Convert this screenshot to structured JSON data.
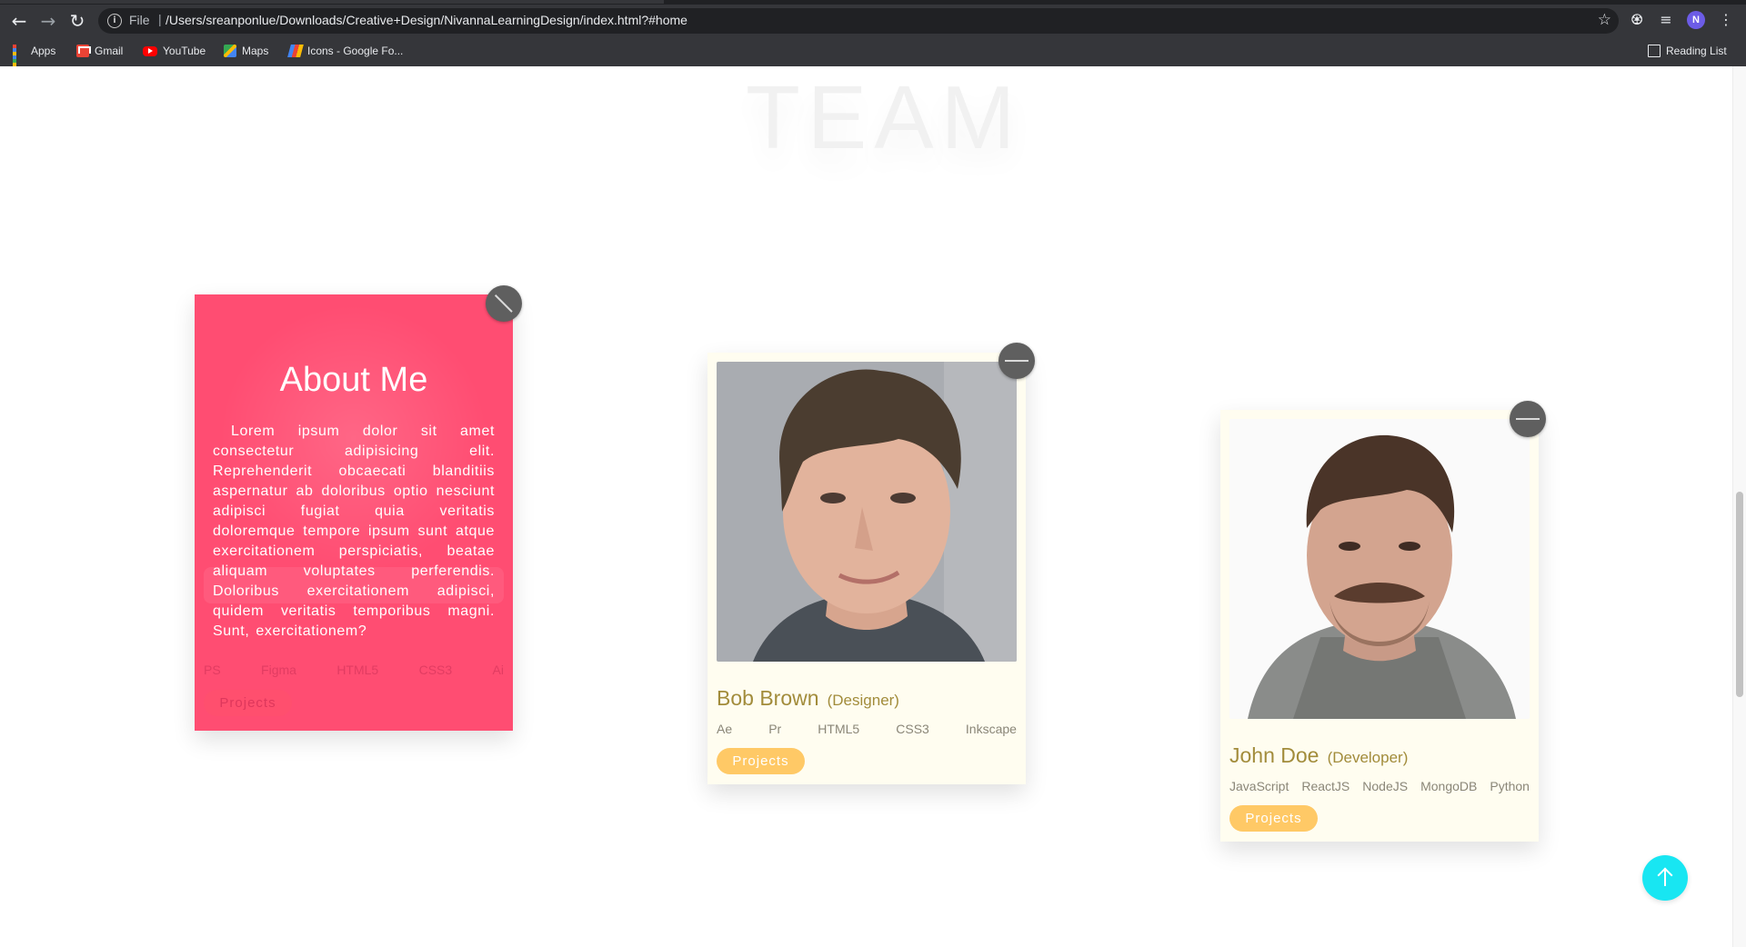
{
  "browser": {
    "url_scheme": "File",
    "url": "/Users/sreanponlue/Downloads/Creative+Design/NivannaLearningDesign/index.html?#home",
    "profile_initial": "N",
    "bookmarks": [
      {
        "label": "Apps",
        "icon": "apps-grid-icon"
      },
      {
        "label": "Gmail",
        "icon": "gmail-icon"
      },
      {
        "label": "YouTube",
        "icon": "youtube-icon"
      },
      {
        "label": "Maps",
        "icon": "maps-icon"
      },
      {
        "label": "Icons - Google Fo...",
        "icon": "google-fonts-icon"
      }
    ],
    "reading_list_label": "Reading List"
  },
  "page": {
    "section_title": "TEAM",
    "about_card": {
      "title": "About Me",
      "text": "Lorem ipsum dolor sit amet consectetur adipisicing elit. Reprehenderit obcaecati blanditiis aspernatur ab doloribus optio nesciunt adipisci fugiat quia veritatis doloremque tempore ipsum sunt atque exercitationem perspiciatis, beatae aliquam voluptates perferendis. Doloribus exercitationem adipisci, quidem veritatis temporibus magni. Sunt, exercitationem?",
      "ghost_skills": [
        "PS",
        "Figma",
        "HTML5",
        "CSS3",
        "Ai"
      ],
      "ghost_button": "Projects"
    },
    "members": [
      {
        "name": "Bob Brown",
        "role": "(Designer)",
        "skills": [
          "Ae",
          "Pr",
          "HTML5",
          "CSS3",
          "Inkscape"
        ],
        "button": "Projects"
      },
      {
        "name": "John Doe",
        "role": "(Developer)",
        "skills": [
          "JavaScript",
          "ReactJS",
          "NodeJS",
          "MongoDB",
          "Python"
        ],
        "button": "Projects"
      }
    ],
    "colors": {
      "about_bg": "#ff4d72",
      "card_bg": "#fffdf0",
      "name_text": "#a28c3b",
      "project_button": "#ffc966",
      "back_to_top": "#18e6f2"
    }
  }
}
